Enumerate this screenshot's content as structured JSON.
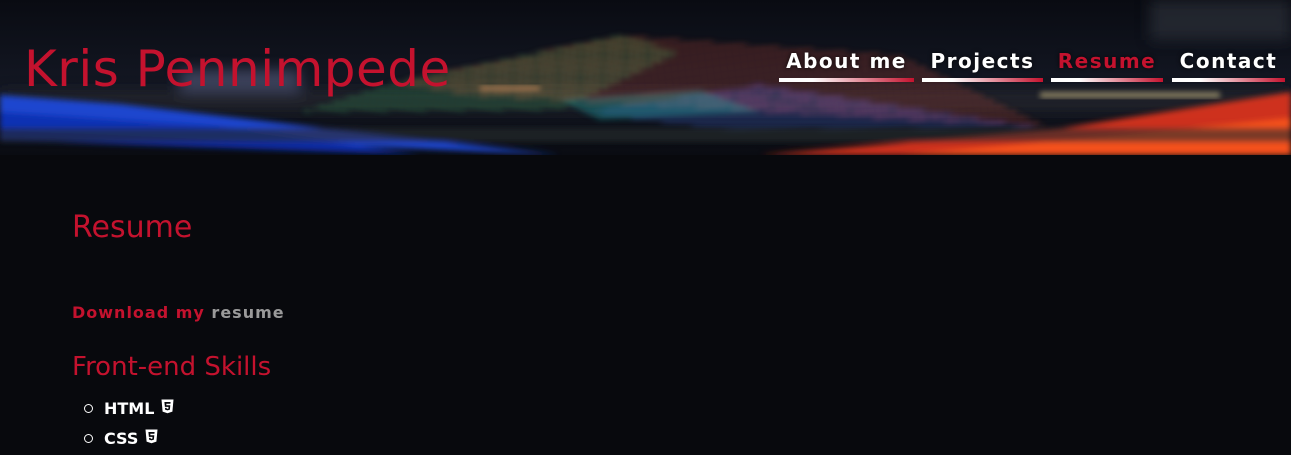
{
  "site": {
    "title": "Kris Pennimpede",
    "accent_color": "#c4122e",
    "background_color": "#08090d"
  },
  "nav": {
    "items": [
      {
        "label": "About me",
        "active": false
      },
      {
        "label": "Projects",
        "active": false
      },
      {
        "label": "Resume",
        "active": true
      },
      {
        "label": "Contact",
        "active": false
      }
    ]
  },
  "header": {
    "background_image": "blurred long-exposure photo of colored light trails over a dark city"
  },
  "main": {
    "heading": "Resume",
    "download": {
      "text": "Download my",
      "link_label": "resume"
    },
    "skills_section": {
      "heading": "Front-end Skills",
      "items": [
        {
          "label": "HTML",
          "icon": "html5-icon"
        },
        {
          "label": "CSS",
          "icon": "css3-icon"
        }
      ]
    }
  }
}
